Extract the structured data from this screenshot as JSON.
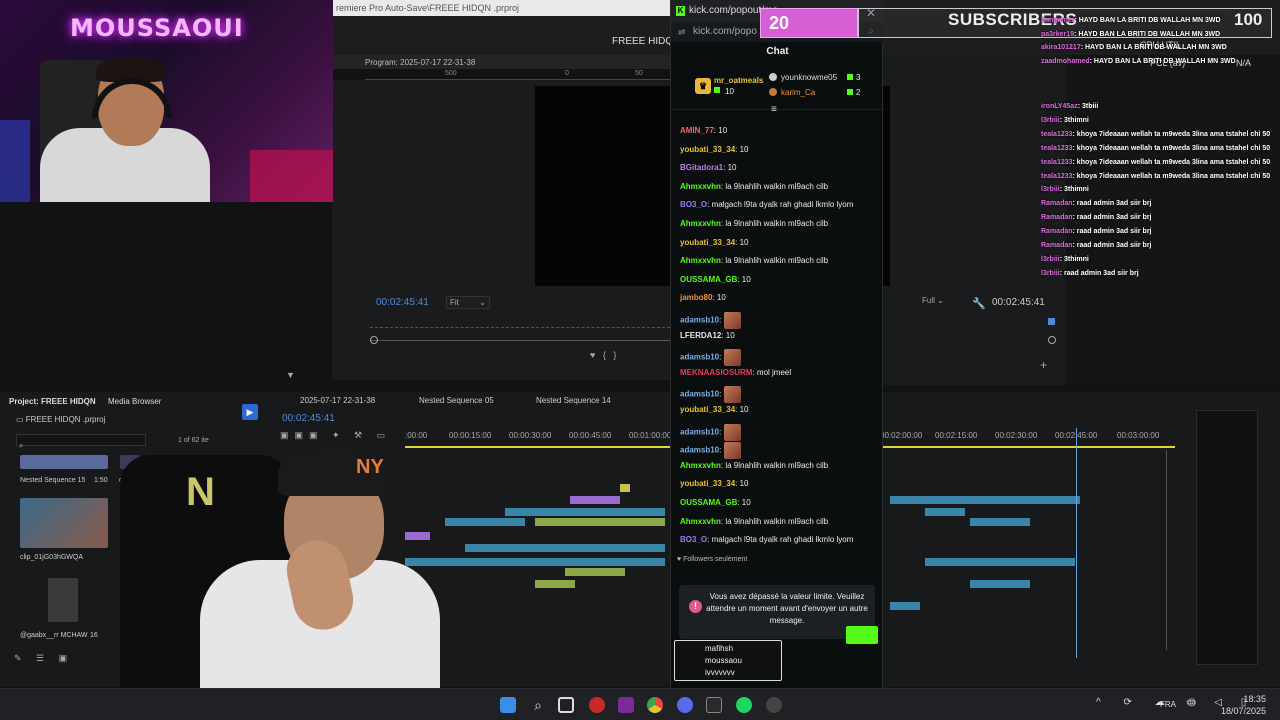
{
  "premiere": {
    "titlebar": "remiere Pro Auto-Save\\FREEE HIDQN .prproj",
    "app_title": "FREEE HIDQN",
    "program_label": "Program: 2025-07-17 22-31-38",
    "timecode_left": "00:02:45:41",
    "timecode_right": "00:02:45:41",
    "fit": "Fit",
    "full": "Full",
    "project_tab": "Project: FREEE HIDQN",
    "media_browser": "Media Browser",
    "project_file": "FREEE HIDQN .prproj",
    "items_count": "1 of 62 ite",
    "seq_tabs": [
      "2025-07-17 22-31-38",
      "Nested Sequence 05",
      "Nested Sequence 14"
    ],
    "timeline_timecode": "00:02:45:41",
    "timeline_ticks": [
      ":00:00",
      "00:00:15:00",
      "00:00:30:00",
      "00:00:45:00",
      "00:01:00:00",
      "00:02:00:00",
      "00:02:15:00",
      "00:02:30:00",
      "00:02:45:00",
      "00:03:00:00"
    ],
    "bin_items": [
      "Nested Sequence 15",
      "1:50",
      "clip_01",
      "clip_01jG03hGWQA",
      "@gaabx__rr MCHAW",
      "16"
    ],
    "ruler_left": "00:00:00",
    "ruler_mid": "500",
    "ruler_mid2": "0",
    "ruler_mid3": "50"
  },
  "webcam": {
    "sign_text": "MOUSSAOUI"
  },
  "kick": {
    "url": "kick.com/popout/mo",
    "url2": "kick.com/popo",
    "chat_title": "Chat",
    "leaderboard": {
      "first": {
        "name": "mr_oatmeals",
        "count": "10"
      },
      "second": {
        "name": "younknowme05",
        "count": "3"
      },
      "third": {
        "name": "karim_Ca",
        "count": "2"
      }
    },
    "messages": [
      {
        "user": "AMIN_77",
        "color": "#e86a6a",
        "text": ": 10"
      },
      {
        "user": "youbati_33_34",
        "color": "#e8c23a",
        "text": ": 10"
      },
      {
        "user": "BGitadora1",
        "color": "#c27ae8",
        "text": ": 10"
      },
      {
        "user": "Ahmxxvhn",
        "color": "#53fc18",
        "text": ": la 9lnahlih walkin ml9ach cilb"
      },
      {
        "user": "BO3_O",
        "color": "#9a7ae8",
        "text": ": malgach l9ta dyalk rah ghadi lkmlo lyom"
      },
      {
        "user": "Ahmxxvhn",
        "color": "#53fc18",
        "text": ": la 9lnahlih walkin ml9ach cilb"
      },
      {
        "user": "youbati_33_34",
        "color": "#e8c23a",
        "text": ": 10"
      },
      {
        "user": "Ahmxxvhn",
        "color": "#53fc18",
        "text": ": la 9lnahlih walkin ml9ach cilb"
      },
      {
        "user": "OUSSAMA_GB",
        "color": "#53fc18",
        "text": ": 10"
      },
      {
        "user": "jambo80",
        "color": "#e8923a",
        "text": ": 10"
      },
      {
        "user": "adamsb10",
        "color": "#7ab0e8",
        "text": ":",
        "emote": true
      },
      {
        "user": "LFERDA12",
        "color": "#e8e8e8",
        "text": ": 10"
      },
      {
        "user": "adamsb10",
        "color": "#7ab0e8",
        "text": ":",
        "emote": true
      },
      {
        "user": "MEKNAASIOSURM",
        "color": "#e83a5a",
        "text": ": mol jmeel"
      },
      {
        "user": "adamsb10",
        "color": "#7ab0e8",
        "text": ":",
        "emote": true
      },
      {
        "user": "youbati_33_34",
        "color": "#e8c23a",
        "text": ": 10"
      },
      {
        "user": "adamsb10",
        "color": "#7ab0e8",
        "text": ":",
        "emote": true
      },
      {
        "user": "adamsb10",
        "color": "#7ab0e8",
        "text": ":",
        "emote": true
      },
      {
        "user": "Ahmxxvhn",
        "color": "#53fc18",
        "text": ": la 9lnahlih walkin ml9ach cilb"
      },
      {
        "user": "youbati_33_34",
        "color": "#e8c23a",
        "text": ": 10"
      },
      {
        "user": "OUSSAMA_GB",
        "color": "#53fc18",
        "text": ": 10"
      },
      {
        "user": "Ahmxxvhn",
        "color": "#53fc18",
        "text": ": la 9lnahlih walkin ml9ach cilb"
      },
      {
        "user": "BO3_O",
        "color": "#9a7ae8",
        "text": ": malgach l9ta dyalk rah ghadi lkmlo lyom"
      }
    ],
    "followers_only": "Followers seulement",
    "alert_text": "Vous avez dépassé la valeur limite. Veuillez attendre un moment avant d'envoyer un autre message.",
    "input_lines": [
      "mafihsh",
      "moussaou",
      "ivvvvvvv"
    ]
  },
  "overlay": {
    "sub_goal_current": "20",
    "sub_label": "SUBSCRIBERS",
    "sub_goal_target": "100",
    "cpu": "CPU UTIL",
    "pcl": "PCL (av)",
    "na": "N/A",
    "right_chat": [
      {
        "user": "bangamer",
        "text": ": HAYD BAN LA BRITI DB WALLAH MN 3WD"
      },
      {
        "user": "pa3rker19",
        "text": ": HAYD BAN LA BRITI DB WALLAH MN 3WD"
      },
      {
        "user": "akira101217",
        "text": ": HAYD BAN LA BRITI DB WALLAH MN 3WD"
      },
      {
        "user": "zaadmohamed",
        "text": ": HAYD BAN LA BRITI DB WALLAH MN 3WD"
      },
      {
        "user": "ironLY45az",
        "text": ": 3tbiii"
      },
      {
        "user": "l3rbiii",
        "text": ": 3thimni"
      },
      {
        "user": "teala1233",
        "text": ": khoya 7ideaaan wellah ta m9weda 3lina ama tstahel chi 50"
      },
      {
        "user": "teala1233",
        "text": ": khoya 7ideaaan wellah ta m9weda 3lina ama tstahel chi 50"
      },
      {
        "user": "teala1233",
        "text": ": khoya 7ideaaan wellah ta m9weda 3lina ama tstahel chi 50"
      },
      {
        "user": "teala1233",
        "text": ": khoya 7ideaaan wellah ta m9weda 3lina ama tstahel chi 50"
      },
      {
        "user": "l3rbiii",
        "text": ": 3thimni"
      },
      {
        "user": "Ramadan",
        "text": ": raad admin 3ad siir brj"
      },
      {
        "user": "Ramadan",
        "text": ": raad admin 3ad siir brj"
      },
      {
        "user": "Ramadan",
        "text": ": raad admin 3ad siir brj"
      },
      {
        "user": "Ramadan",
        "text": ": raad admin 3ad siir brj"
      },
      {
        "user": "l3rbiii",
        "text": ": 3thimni"
      },
      {
        "user": "l3rbiii",
        "text": ": raad admin 3ad siir brj"
      }
    ]
  },
  "taskbar": {
    "lang": "FRA",
    "time": "18:35",
    "date": "18/07/2025"
  }
}
